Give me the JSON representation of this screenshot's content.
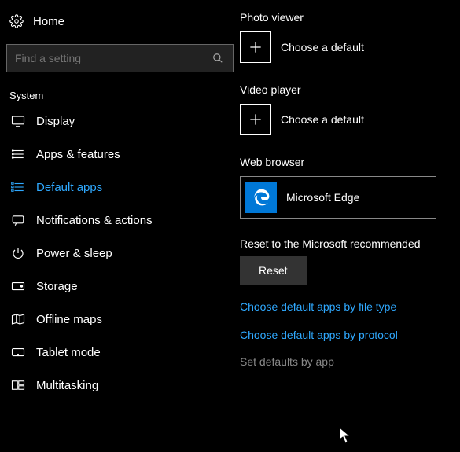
{
  "sidebar": {
    "home_label": "Home",
    "search_placeholder": "Find a setting",
    "group_label": "System",
    "items": [
      {
        "label": "Display"
      },
      {
        "label": "Apps & features"
      },
      {
        "label": "Default apps"
      },
      {
        "label": "Notifications & actions"
      },
      {
        "label": "Power & sleep"
      },
      {
        "label": "Storage"
      },
      {
        "label": "Offline maps"
      },
      {
        "label": "Tablet mode"
      },
      {
        "label": "Multitasking"
      }
    ]
  },
  "main": {
    "photo_viewer_label": "Photo viewer",
    "choose_default_label": "Choose a default",
    "video_player_label": "Video player",
    "web_browser_label": "Web browser",
    "web_browser_app": "Microsoft Edge",
    "reset_caption": "Reset to the Microsoft recommended",
    "reset_button": "Reset",
    "link_filetype": "Choose default apps by file type",
    "link_protocol": "Choose default apps by protocol",
    "link_setbyapp": "Set defaults by app"
  }
}
